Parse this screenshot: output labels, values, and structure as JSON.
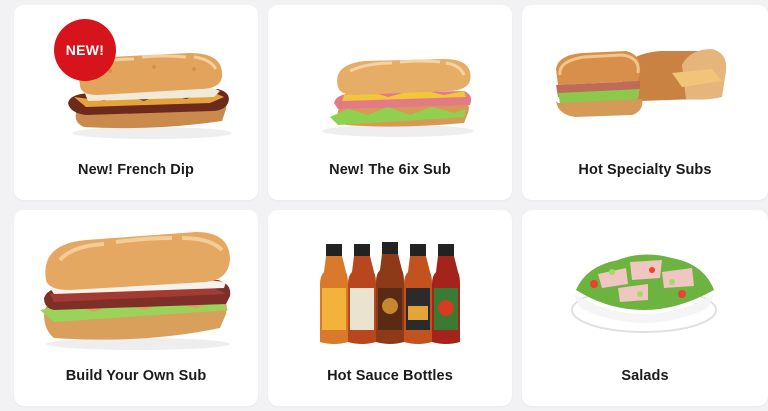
{
  "menu": {
    "items": [
      {
        "label": "New! French Dip",
        "badge": "NEW!",
        "icon": "french-dip-sub-image"
      },
      {
        "label": "New! The 6ix Sub",
        "icon": "6ix-sub-image"
      },
      {
        "label": "Hot Specialty Subs",
        "icon": "specialty-subs-image"
      },
      {
        "label": "Build Your Own Sub",
        "icon": "build-your-own-sub-image"
      },
      {
        "label": "Hot Sauce Bottles",
        "icon": "hot-sauce-bottles-image"
      },
      {
        "label": "Salads",
        "icon": "salad-image"
      }
    ]
  },
  "colors": {
    "badge": "#d7141b",
    "card": "#ffffff",
    "background": "#f2f2f4"
  }
}
